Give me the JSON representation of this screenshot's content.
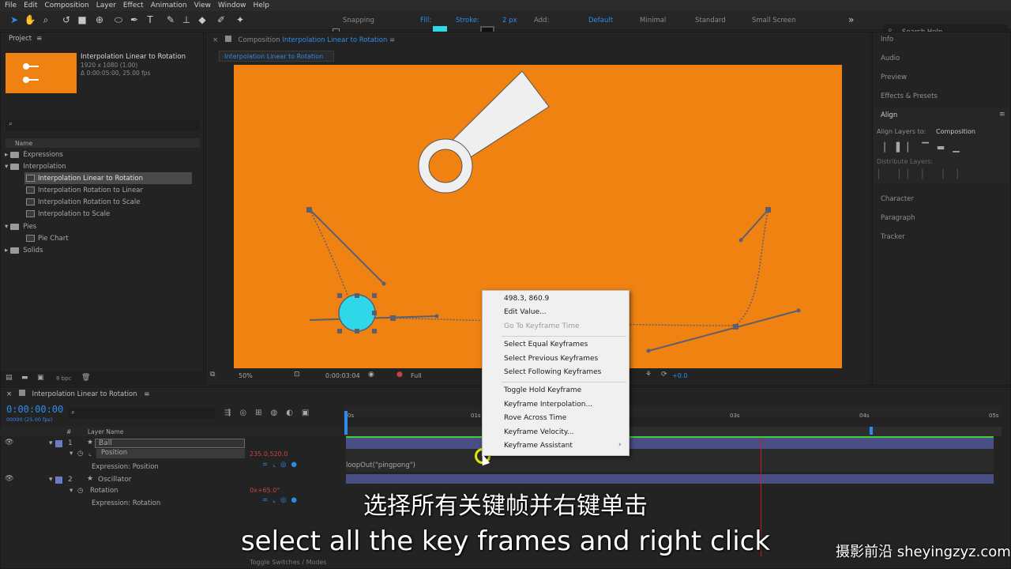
{
  "menu": [
    "File",
    "Edit",
    "Composition",
    "Layer",
    "Effect",
    "Animation",
    "View",
    "Window",
    "Help"
  ],
  "toolbar": {
    "snapping": "Snapping",
    "fill": "Fill:",
    "stroke": "Stroke:",
    "stroke_px": "2 px",
    "add": "Add:",
    "workspaces": [
      "Default",
      "Minimal",
      "Standard",
      "Small Screen"
    ],
    "search_placeholder": "Search Help",
    "fill_color": "#2fd8e8"
  },
  "project": {
    "title": "Project",
    "comp_name": "Interpolation Linear to Rotation",
    "comp_size": "1920 x 1080 (1.00)",
    "comp_duration": "Δ 0:00:05:00, 25.00 fps",
    "column_name": "Name",
    "items": [
      {
        "label": "Expressions",
        "type": "folder"
      },
      {
        "label": "Interpolation",
        "type": "folder"
      },
      {
        "label": "Interpolation Linear to Rotation",
        "type": "comp"
      },
      {
        "label": "Interpolation Rotation to Linear",
        "type": "comp"
      },
      {
        "label": "Interpolation Rotation to Scale",
        "type": "comp"
      },
      {
        "label": "Interpolation to Scale",
        "type": "comp"
      },
      {
        "label": "Pies",
        "type": "folder"
      },
      {
        "label": "Pie Chart",
        "type": "comp"
      },
      {
        "label": "Solids",
        "type": "folder"
      }
    ],
    "bpc": "8 bpc"
  },
  "composition": {
    "panel_label": "Composition",
    "panel_name": "Interpolation Linear to Rotation",
    "tab": "Interpolation Linear to Rotation",
    "zoom": "50%",
    "timecode": "0:00:03:04",
    "resolution": "Full",
    "exposure": "+0.0",
    "bg_color": "#ef8211"
  },
  "context_menu": {
    "items": [
      {
        "label": "498.3, 860.9",
        "disabled": false
      },
      {
        "label": "Edit Value...",
        "disabled": false
      },
      {
        "label": "Go To Keyframe Time",
        "disabled": true
      },
      {
        "label": "Select Equal Keyframes",
        "disabled": false
      },
      {
        "label": "Select Previous Keyframes",
        "disabled": false
      },
      {
        "label": "Select Following Keyframes",
        "disabled": false
      },
      {
        "label": "Toggle Hold Keyframe",
        "disabled": false
      },
      {
        "label": "Keyframe Interpolation...",
        "disabled": false
      },
      {
        "label": "Rove Across Time",
        "disabled": false
      },
      {
        "label": "Keyframe Velocity...",
        "disabled": false
      },
      {
        "label": "Keyframe Assistant",
        "disabled": false
      }
    ]
  },
  "right_panels": {
    "items": [
      "Info",
      "Audio",
      "Preview",
      "Effects & Presets"
    ],
    "align": "Align",
    "align_layers_to": "Align Layers to:",
    "align_target": "Composition",
    "distribute_layers": "Distribute Layers:",
    "bottom_items": [
      "Character",
      "Paragraph",
      "Tracker"
    ]
  },
  "timeline": {
    "tab": "Interpolation Linear to Rotation",
    "timecode": "0:00:00:00",
    "subtimecode": "00000 (25.00 fps)",
    "col_hash": "#",
    "col_layer_name": "Layer Name",
    "ruler": [
      "0s",
      "01s",
      "03s",
      "04s",
      "05s"
    ],
    "layers": [
      {
        "num": "1",
        "name": "Ball",
        "prop": "Position",
        "value": "235.0,520.0",
        "expr_label": "Expression: Position",
        "expr": "loopOut(\"pingpong\")"
      },
      {
        "num": "2",
        "name": "Oscillator",
        "prop": "Rotation",
        "value": "0x+65.0°",
        "expr_label": "Expression: Rotation"
      }
    ],
    "toggle_label": "Toggle Switches / Modes"
  },
  "subtitles": {
    "cn": "选择所有关键帧并右键单击",
    "en": "select all the key frames and right click"
  },
  "watermark": "摄影前沿 sheyingzyz.com"
}
